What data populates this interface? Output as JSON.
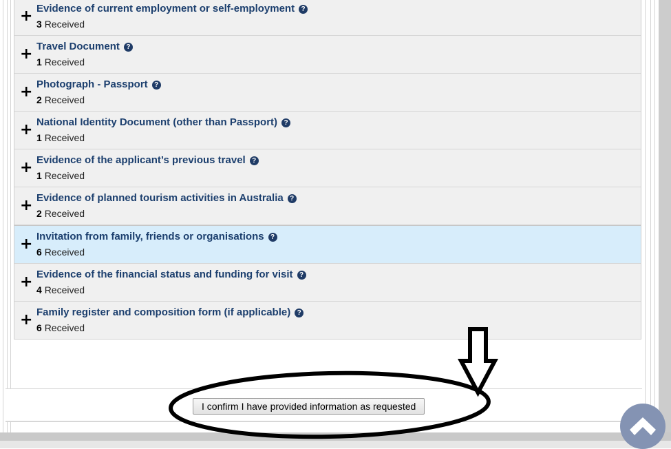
{
  "panel": {
    "name": "document-checklist",
    "rows": [
      {
        "title": "Evidence of current employment or self-employment",
        "count": "3",
        "status_label": "Received",
        "help": "?",
        "toggle": "+",
        "selected": false
      },
      {
        "title": "Travel Document",
        "count": "1",
        "status_label": "Received",
        "help": "?",
        "toggle": "+",
        "selected": false
      },
      {
        "title": "Photograph - Passport",
        "count": "2",
        "status_label": "Received",
        "help": "?",
        "toggle": "+",
        "selected": false
      },
      {
        "title": "National Identity Document (other than Passport)",
        "count": "1",
        "status_label": "Received",
        "help": "?",
        "toggle": "+",
        "selected": false
      },
      {
        "title": "Evidence of the applicant’s previous travel",
        "count": "1",
        "status_label": "Received",
        "help": "?",
        "toggle": "+",
        "selected": false
      },
      {
        "title": "Evidence of planned tourism activities in Australia",
        "count": "2",
        "status_label": "Received",
        "help": "?",
        "toggle": "+",
        "selected": false
      },
      {
        "title": "Invitation from family, friends or organisations",
        "count": "6",
        "status_label": "Received",
        "help": "?",
        "toggle": "+",
        "selected": true
      },
      {
        "title": "Evidence of the financial status and funding for visit",
        "count": "4",
        "status_label": "Received",
        "help": "?",
        "toggle": "+",
        "selected": false
      },
      {
        "title": "Family register and composition form (if applicable)",
        "count": "6",
        "status_label": "Received",
        "help": "?",
        "toggle": "+",
        "selected": false
      }
    ]
  },
  "confirm": {
    "button_label": "I confirm I have provided information as requested"
  },
  "scroll_top": {
    "icon": "chevron-up-icon"
  },
  "annotations": {
    "ellipse": "highlight-ellipse",
    "arrow": "down-arrow"
  },
  "colors": {
    "row_background": "#f0f0f0",
    "row_selected_background": "#d7edfb",
    "title_text": "#1c3f6e",
    "help_icon_background": "#1f3b66",
    "scroll_top_background": "#8493b3",
    "annotation_ink": "#000000",
    "footer_band": "#c9c9c9"
  }
}
